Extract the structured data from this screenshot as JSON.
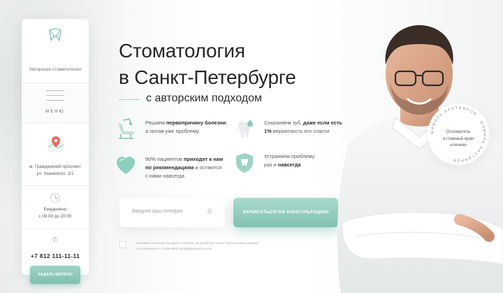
{
  "sidebar": {
    "brand": "Авторская стоматология",
    "menu_label": "МЕНЮ",
    "address_line1": "м. Гражданский проспект",
    "address_line2": "ул. Ушинского, 2/1",
    "hours_line1": "Ежедневно",
    "hours_line2": "с 09:00 до 20:00",
    "phone": "+7 812 111-11-11",
    "ask_button": "ЗАДАТЬ ВОПРОС"
  },
  "hero": {
    "title_line1": "Стоматология",
    "title_line2": "в Санкт-Петербурге",
    "subtitle": "с авторским подходом"
  },
  "features": [
    {
      "icon": "dental-chair-icon",
      "pre": "Решаем ",
      "bold": "первопричину болезни",
      "post": ",",
      "line2": "а потом уже проблему"
    },
    {
      "icon": "tooth-drop-icon",
      "pre": "Сохраняем зуб, ",
      "bold": "даже если есть",
      "post": "",
      "line2_bold": "1%",
      "line2": " вероятность его спасти"
    },
    {
      "icon": "heart-icon",
      "pre": "90% пациентов ",
      "bold": "приходят к нам",
      "post": "",
      "line2_bold": "по рекомендациям",
      "line2": " и остаются",
      "line3": "с нами навсегда"
    },
    {
      "icon": "shield-tooth-icon",
      "pre": "Устраняем проблему",
      "bold": "",
      "post": "",
      "line2": "раз и ",
      "line2_bold_end": "навсегда"
    }
  ],
  "form": {
    "phone_placeholder": "Введите ваш телефон",
    "cta_label": "ЗАПИСАТЬСЯ НА КОНСУЛЬТАЦИЮ",
    "consent_line1": "Нажимая на кнопку, вы даете согласие на обработку своих персональных данных",
    "consent_line2": "и соглашаетесь с политикой конфиденциальности."
  },
  "doctor_badge": {
    "ring_text": "ШАМИЛЬ БАХТИЯРОВ · ШАМИЛЬ БАХТИЯРОВ ·",
    "line1": "Основатель",
    "line2": "и главный врач",
    "line3": "клиники"
  },
  "colors": {
    "accent": "#8cc7b9",
    "text": "#2b2f33"
  }
}
